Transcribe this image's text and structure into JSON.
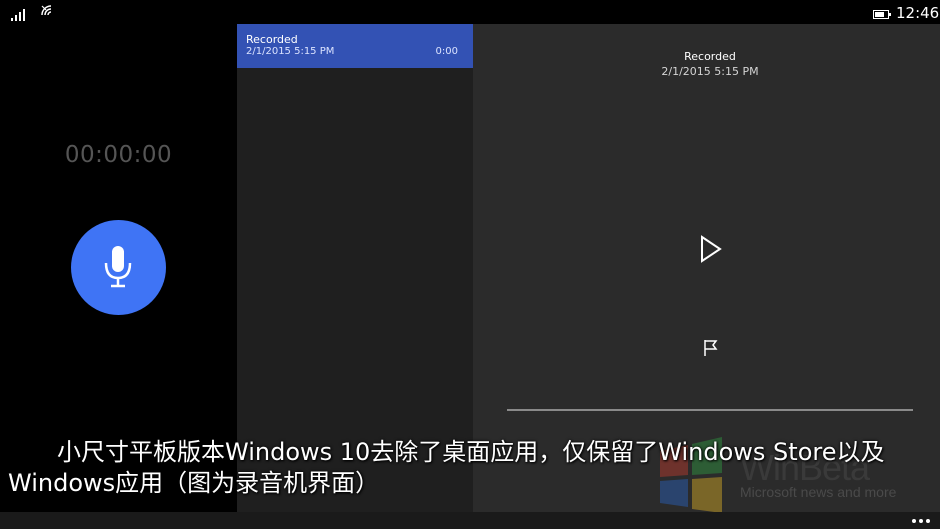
{
  "status_bar": {
    "time": "12:46",
    "icons": [
      "signal-icon",
      "wifi-icon",
      "battery-icon"
    ]
  },
  "recorder": {
    "timer": "00:00:00",
    "mic_icon": "microphone-icon",
    "accent": "#3f74f5"
  },
  "recordings": [
    {
      "title": "Recorded",
      "date": "2/1/2015 5:15 PM",
      "duration": "0:00"
    }
  ],
  "detail": {
    "title": "Recorded",
    "date": "2/1/2015 5:15 PM",
    "play_icon": "play-icon",
    "flag_icon": "flag-icon",
    "progress": 0
  },
  "watermark": {
    "logo": "WinBeta",
    "tagline": "Microsoft news and more"
  },
  "caption": {
    "line1": "小尺寸平板版本Windows 10去除了桌面应用，仅保留了Windows Store以及",
    "line2": "Windows应用（图为录音机界面）"
  },
  "app_bar": {
    "more_icon": "more-icon"
  },
  "colors": {
    "selected_item": "#3352b4",
    "list_bg": "#1f1f1f",
    "detail_bg": "#2b2b2b"
  }
}
